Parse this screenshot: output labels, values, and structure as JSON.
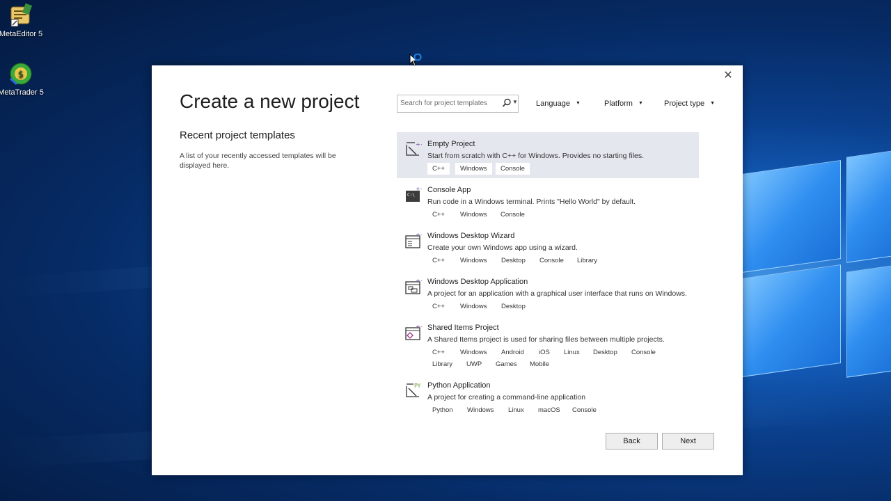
{
  "desktop": {
    "icons": [
      {
        "label": "MetaEditor 5",
        "icon": "metaeditor-icon"
      },
      {
        "label": "MetaTrader 5",
        "icon": "metatrader-icon"
      }
    ]
  },
  "dialog": {
    "title": "Create a new project",
    "close_icon": "close-icon",
    "recent": {
      "title": "Recent project templates",
      "description": "A list of your recently accessed templates will be displayed here."
    },
    "search": {
      "placeholder": "Search for project templates",
      "value": ""
    },
    "filters": {
      "language": "Language",
      "platform": "Platform",
      "project_type": "Project type"
    },
    "templates": [
      {
        "name": "Empty Project",
        "description": "Start from scratch with C++ for Windows. Provides no starting files.",
        "tags": [
          "C++",
          "Windows",
          "Console"
        ],
        "selected": true,
        "icon": "empty-project-icon"
      },
      {
        "name": "Console App",
        "description": "Run code in a Windows terminal. Prints \"Hello World\" by default.",
        "tags": [
          "C++",
          "Windows",
          "Console"
        ],
        "selected": false,
        "icon": "console-app-icon"
      },
      {
        "name": "Windows Desktop Wizard",
        "description": "Create your own Windows app using a wizard.",
        "tags": [
          "C++",
          "Windows",
          "Desktop",
          "Console",
          "Library"
        ],
        "selected": false,
        "icon": "desktop-wizard-icon"
      },
      {
        "name": "Windows Desktop Application",
        "description": "A project for an application with a graphical user interface that runs on Windows.",
        "tags": [
          "C++",
          "Windows",
          "Desktop"
        ],
        "selected": false,
        "icon": "desktop-application-icon"
      },
      {
        "name": "Shared Items Project",
        "description": "A Shared Items project is used for sharing files between multiple projects.",
        "tags": [
          "C++",
          "Windows",
          "Android",
          "iOS",
          "Linux",
          "Desktop",
          "Console",
          "Library",
          "UWP",
          "Games",
          "Mobile"
        ],
        "selected": false,
        "icon": "shared-items-icon"
      },
      {
        "name": "Python Application",
        "description": "A project for creating a command-line application",
        "tags": [
          "Python",
          "Windows",
          "Linux",
          "macOS",
          "Console"
        ],
        "selected": false,
        "icon": "python-application-icon"
      }
    ],
    "buttons": {
      "back": "Back",
      "next": "Next"
    }
  }
}
